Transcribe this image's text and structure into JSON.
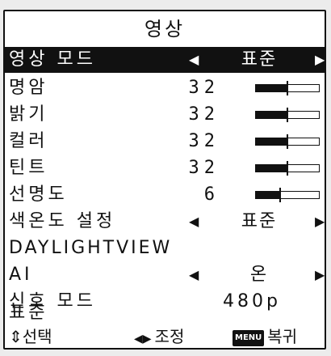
{
  "menu": {
    "title": "영상",
    "picture_mode": {
      "label": "영상 모드",
      "value": "표준"
    },
    "sliders": [
      {
        "label": "명암",
        "value": 32,
        "level": 0.5
      },
      {
        "label": "밝기",
        "value": 32,
        "level": 0.5
      },
      {
        "label": "컬러",
        "value": 32,
        "level": 0.5
      },
      {
        "label": "틴트",
        "value": 32,
        "level": 0.5
      },
      {
        "label": "선명도",
        "value": 6,
        "level": 0.38
      }
    ],
    "color_temp": {
      "label": "색온도 설정",
      "value": "표준"
    },
    "daylight": {
      "label": "DAYLIGHTVIEW"
    },
    "ai": {
      "label": "AI",
      "value": "온"
    },
    "signal_mode": {
      "label": "신호 모드",
      "value": "480p"
    },
    "standard": {
      "label": "표준"
    }
  },
  "footer": {
    "select": "선택",
    "adjust": "조정",
    "menu_key": "MENU",
    "back": "복귀"
  },
  "icons": {
    "left": "◀",
    "right": "▶",
    "updown": "⇕",
    "leftright": "◀▶"
  },
  "colors": {
    "fg": "#111111",
    "bg": "#ffffff"
  }
}
